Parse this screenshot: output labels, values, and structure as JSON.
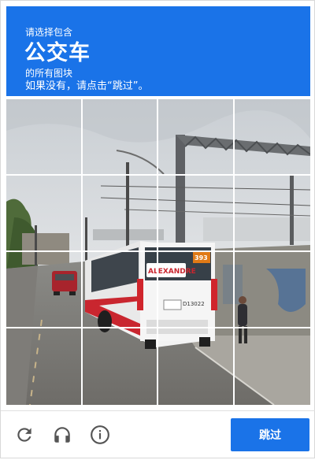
{
  "header": {
    "line1": "请选择包含",
    "keyword": "公交车",
    "line2": "的所有图块",
    "line3": "如果没有，请点击“跳过”。"
  },
  "bus": {
    "destination": "ALEXANDRE",
    "route_number": "393",
    "fleet_number": "D13022"
  },
  "grid": {
    "rows": 4,
    "columns": 4
  },
  "footer": {
    "reload_icon": "reload-icon",
    "audio_icon": "headphones-icon",
    "info_icon": "info-icon",
    "skip_label": "跳过"
  },
  "colors": {
    "accent": "#1a73e8",
    "icon": "#555555"
  }
}
